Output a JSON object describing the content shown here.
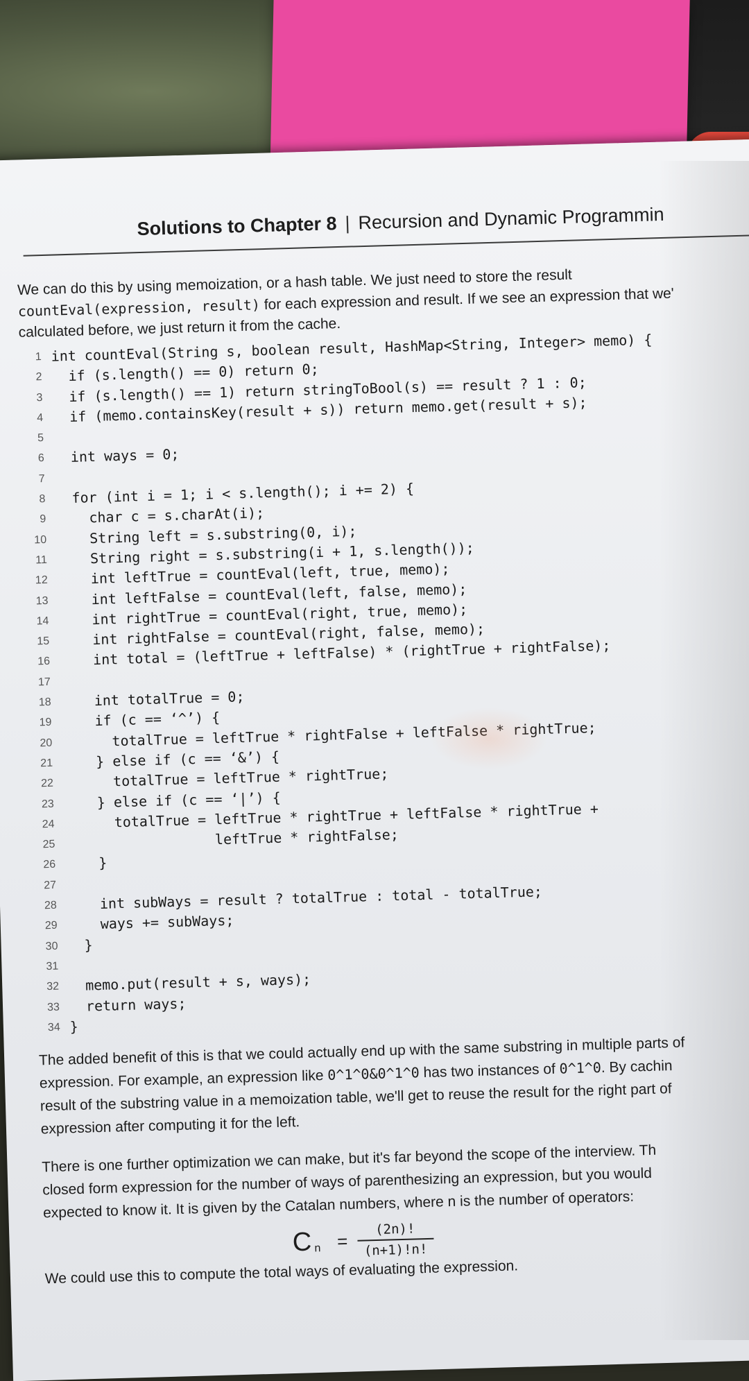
{
  "header": {
    "chapter": "Solutions to Chapter 8",
    "separator": "|",
    "topic": "Recursion and Dynamic Programmin"
  },
  "intro": {
    "line1": "We can do this by using memoization, or a hash table. We just need to store the result",
    "line2_code": "countEval(expression, result)",
    "line2_text": " for each expression and result. If we see an expression that we'",
    "line3": "calculated before, we just return it from the cache."
  },
  "code": [
    {
      "n": "1",
      "t": "int countEval(String s, boolean result, HashMap<String, Integer> memo) {"
    },
    {
      "n": "2",
      "t": "  if (s.length() == 0) return 0;"
    },
    {
      "n": "3",
      "t": "  if (s.length() == 1) return stringToBool(s) == result ? 1 : 0;"
    },
    {
      "n": "4",
      "t": "  if (memo.containsKey(result + s)) return memo.get(result + s);"
    },
    {
      "n": "5",
      "t": ""
    },
    {
      "n": "6",
      "t": "  int ways = 0;"
    },
    {
      "n": "7",
      "t": ""
    },
    {
      "n": "8",
      "t": "  for (int i = 1; i < s.length(); i += 2) {"
    },
    {
      "n": "9",
      "t": "    char c = s.charAt(i);"
    },
    {
      "n": "10",
      "t": "    String left = s.substring(0, i);"
    },
    {
      "n": "11",
      "t": "    String right = s.substring(i + 1, s.length());"
    },
    {
      "n": "12",
      "t": "    int leftTrue = countEval(left, true, memo);"
    },
    {
      "n": "13",
      "t": "    int leftFalse = countEval(left, false, memo);"
    },
    {
      "n": "14",
      "t": "    int rightTrue = countEval(right, true, memo);"
    },
    {
      "n": "15",
      "t": "    int rightFalse = countEval(right, false, memo);"
    },
    {
      "n": "16",
      "t": "    int total = (leftTrue + leftFalse) * (rightTrue + rightFalse);"
    },
    {
      "n": "17",
      "t": ""
    },
    {
      "n": "18",
      "t": "    int totalTrue = 0;"
    },
    {
      "n": "19",
      "t": "    if (c == ‘^’) {"
    },
    {
      "n": "20",
      "t": "      totalTrue = leftTrue * rightFalse + leftFalse * rightTrue;"
    },
    {
      "n": "21",
      "t": "    } else if (c == ‘&’) {"
    },
    {
      "n": "22",
      "t": "      totalTrue = leftTrue * rightTrue;"
    },
    {
      "n": "23",
      "t": "    } else if (c == ‘|’) {"
    },
    {
      "n": "24",
      "t": "      totalTrue = leftTrue * rightTrue + leftFalse * rightTrue +"
    },
    {
      "n": "25",
      "t": "                  leftTrue * rightFalse;"
    },
    {
      "n": "26",
      "t": "    }"
    },
    {
      "n": "27",
      "t": ""
    },
    {
      "n": "28",
      "t": "    int subWays = result ? totalTrue : total - totalTrue;"
    },
    {
      "n": "29",
      "t": "    ways += subWays;"
    },
    {
      "n": "30",
      "t": "  }"
    },
    {
      "n": "31",
      "t": ""
    },
    {
      "n": "32",
      "t": "  memo.put(result + s, ways);"
    },
    {
      "n": "33",
      "t": "  return ways;"
    },
    {
      "n": "34",
      "t": "}"
    }
  ],
  "body": {
    "p1_l1": "The added benefit of this is that we could actually end up with the same substring in multiple parts of",
    "p1_l2a": "expression. For example, an expression like ",
    "p1_l2_code1": "0^1^0&0^1^0",
    "p1_l2b": " has two instances of ",
    "p1_l2_code2": "0^1^0",
    "p1_l2c": ". By cachin",
    "p1_l3": "result of the substring value in a memoization table, we'll get to reuse the result for the right part of",
    "p1_l4": "expression after computing it for the left.",
    "p2_l1": "There is one further optimization we can make, but it's far beyond the scope of the interview. Th",
    "p2_l2": "closed form expression for the number of ways of parenthesizing an expression, but you would",
    "p2_l3": "expected to know it. It is given by the Catalan numbers, where n is the number of operators:",
    "formula_c": "C",
    "formula_sub": "n",
    "formula_eq": "=",
    "formula_num": "(2n)!",
    "formula_den": "(n+1)!n!",
    "p3_l1": "We could use this to compute the total ways of evaluating the expression."
  }
}
